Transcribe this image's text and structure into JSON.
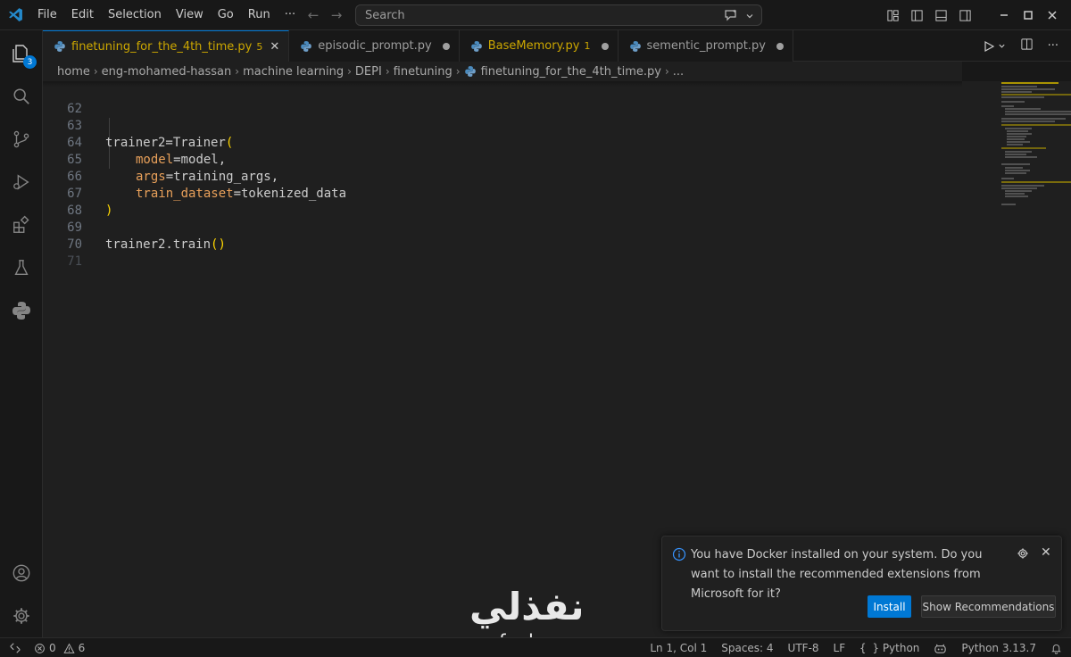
{
  "titlebar": {
    "menu": [
      "File",
      "Edit",
      "Selection",
      "View",
      "Go",
      "Run",
      "···"
    ],
    "search_placeholder": "Search"
  },
  "activity": {
    "explorer_badge": "3"
  },
  "tabs": [
    {
      "label": "finetuning_for_the_4th_time.py",
      "badge": "5",
      "active": true
    },
    {
      "label": "episodic_prompt.py",
      "modified": true
    },
    {
      "label": "BaseMemory.py",
      "badge": "1",
      "modified": true
    },
    {
      "label": "sementic_prompt.py",
      "modified": true
    }
  ],
  "breadcrumb": [
    "home",
    "eng-mohamed-hassan",
    "machine learning",
    "DEPI",
    "finetuning",
    "finetuning_for_the_4th_time.py",
    "..."
  ],
  "editor": {
    "lines": [
      {
        "num": "62",
        "code": ""
      },
      {
        "num": "63",
        "code": "trainer2=Trainer("
      },
      {
        "num": "64",
        "param": "model",
        "value": "=model,"
      },
      {
        "num": "65",
        "param": "args",
        "value": "=training_args,"
      },
      {
        "num": "66",
        "param": "train_dataset",
        "value": "=tokenized_data"
      },
      {
        "num": "67",
        "code": ")"
      },
      {
        "num": "68",
        "code": ""
      },
      {
        "num": "69",
        "code": "trainer2.train()"
      },
      {
        "num": "70",
        "code": ""
      },
      {
        "num": "71",
        "code": ""
      }
    ],
    "colors": {
      "param": "#e8a05a",
      "paren": "#ffd700",
      "text": "#cccccc"
    }
  },
  "notification": {
    "message": "You have Docker installed on your system. Do you want to install the recommended extensions from Microsoft for it?",
    "install_label": "Install",
    "show_label": "Show Recommendations"
  },
  "watermark": {
    "arabic": "نفذلي",
    "latin": "nafezly.com"
  },
  "statusbar": {
    "errors": "0",
    "warnings": "6",
    "position": "Ln 1, Col 1",
    "spaces": "Spaces: 4",
    "encoding": "UTF-8",
    "eol": "LF",
    "language": "Python",
    "interpreter": "Python 3.13.7"
  },
  "accent_color": "#0078d4"
}
